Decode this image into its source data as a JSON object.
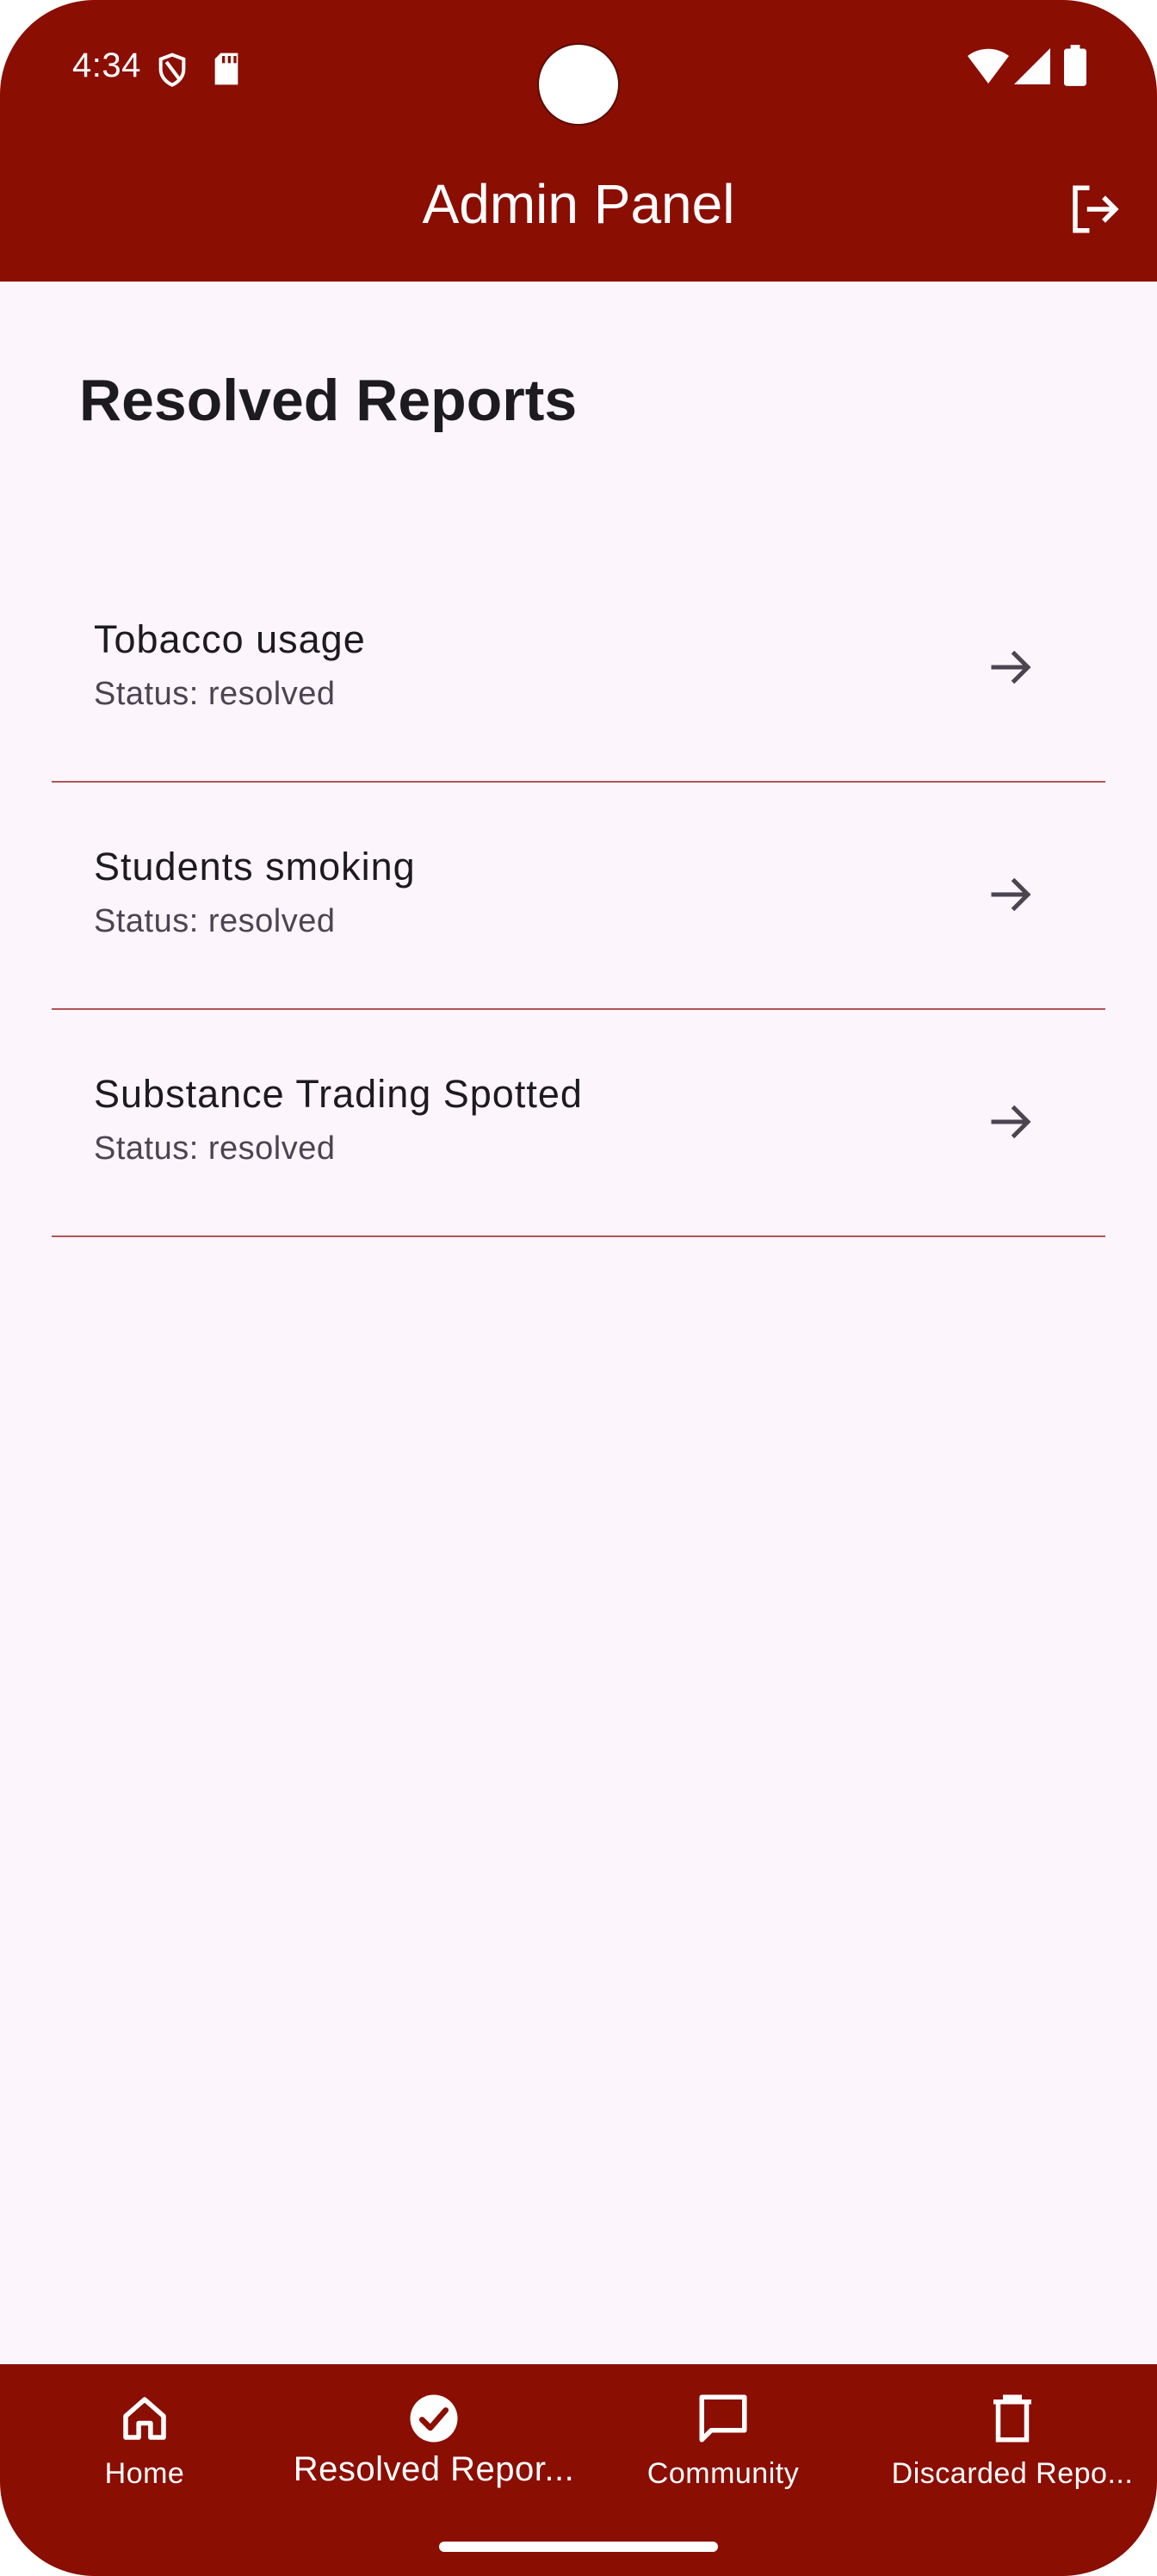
{
  "status_bar": {
    "time": "4:34",
    "icons": [
      "shield-icon",
      "sd-card-icon",
      "wifi-icon",
      "signal-icon",
      "battery-icon"
    ]
  },
  "app_bar": {
    "title": "Admin Panel",
    "action_icon": "logout-icon"
  },
  "page": {
    "title": "Resolved Reports"
  },
  "reports": [
    {
      "title": "Tobacco usage",
      "status": "Status: resolved"
    },
    {
      "title": "Students smoking",
      "status": "Status: resolved"
    },
    {
      "title": "Substance Trading Spotted",
      "status": "Status: resolved"
    }
  ],
  "bottom_nav": [
    {
      "label": "Home",
      "icon": "home-icon",
      "active": false
    },
    {
      "label": "Resolved Repor...",
      "icon": "check-circle-icon",
      "active": true
    },
    {
      "label": "Community",
      "icon": "chat-icon",
      "active": false
    },
    {
      "label": "Discarded Repo...",
      "icon": "trash-icon",
      "active": false
    }
  ],
  "colors": {
    "primary": "#8b0e03",
    "background": "#fcf5fb",
    "divider": "#b0545a",
    "text": "#1d1b20"
  }
}
